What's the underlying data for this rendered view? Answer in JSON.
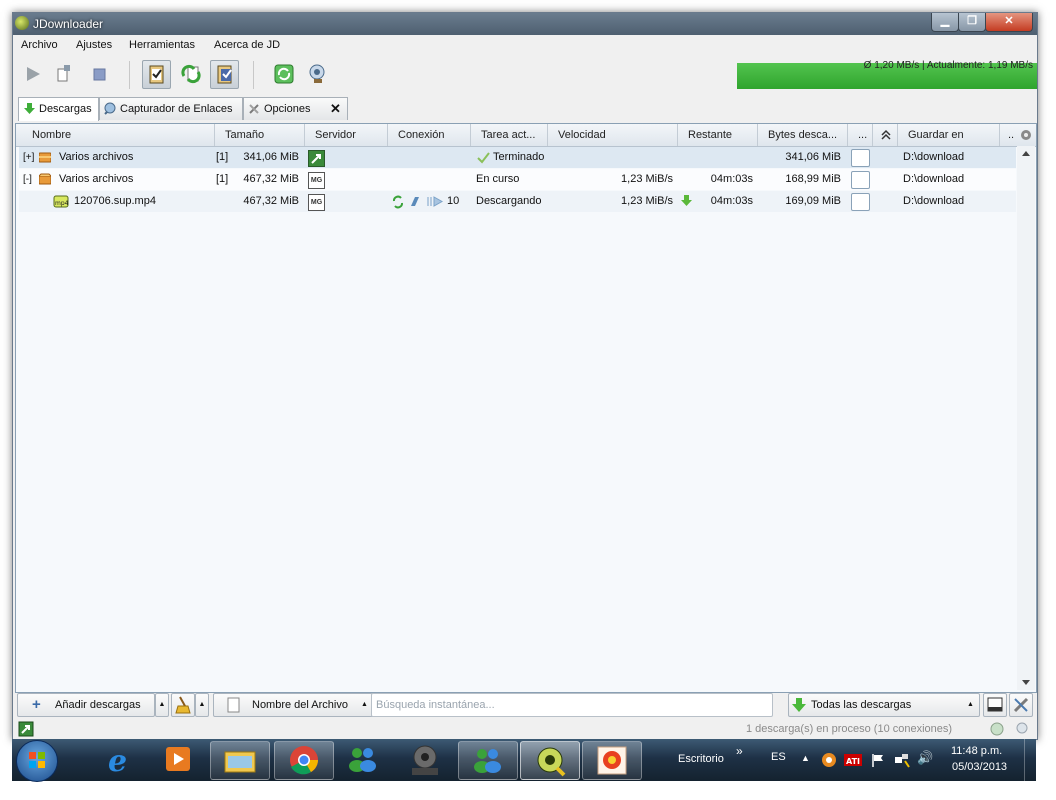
{
  "window": {
    "title": "JDownloader"
  },
  "menu": [
    "Archivo",
    "Ajustes",
    "Herramientas",
    "Acerca de JD"
  ],
  "toolbar": {
    "speed_text": "Ø 1,20 MB/s | Actualmente: 1,19 MB/s",
    "icons": [
      "play-icon",
      "stop-after-icon",
      "stop-icon",
      "clipboard-observe-icon",
      "reconnect-icon",
      "premium-icon",
      "update-icon",
      "plugin-icon"
    ]
  },
  "tabs": [
    {
      "label": "Descargas",
      "icon": "download-arrow-icon"
    },
    {
      "label": "Capturador de Enlaces",
      "icon": "linkgrabber-icon"
    },
    {
      "label": "Opciones",
      "icon": "tools-icon"
    }
  ],
  "table": {
    "columns": [
      "Nombre",
      "Tamaño",
      "Servidor",
      "Conexión",
      "Tarea act...",
      "Velocidad",
      "Restante",
      "Bytes desca...",
      "...",
      "",
      "Guardar en",
      ".."
    ],
    "rows": [
      {
        "expander": "[+]",
        "name": "Varios archivos",
        "count": "[1]",
        "size": "341,06 MiB",
        "host": "hoster-icon",
        "connection": "",
        "status": "Terminado",
        "speed": "",
        "remaining": "",
        "bytes": "341,06 MiB",
        "save": "D:\\download"
      },
      {
        "expander": "[-]",
        "name": "Varios archivos",
        "count": "[1]",
        "size": "467,32 MiB",
        "host": "MG",
        "connection": "",
        "status": "En curso",
        "speed": "1,23 MiB/s",
        "remaining": "04m:03s",
        "bytes": "168,99 MiB",
        "save": "D:\\download"
      },
      {
        "expander": "",
        "name": "120706.sup.mp4",
        "count": "",
        "size": "467,32 MiB",
        "host": "MG",
        "connection": "10",
        "status": "Descargando",
        "speed": "1,23 MiB/s",
        "remaining": "04m:03s",
        "bytes": "169,09 MiB",
        "save": "D:\\download"
      }
    ]
  },
  "bottom": {
    "add_label": "Añadir descargas",
    "filter_label": "Nombre del Archivo",
    "search_placeholder": "Búsqueda instantánea...",
    "all_label": "Todas las descargas"
  },
  "status": {
    "text": "1 descarga(s) en proceso (10 conexiones)"
  },
  "taskbar": {
    "desktop_label": "Escritorio",
    "lang": "ES",
    "time": "11:48 p.m.",
    "date": "05/03/2013",
    "apps": [
      "internet-explorer-icon",
      "media-player-icon",
      "file-explorer-icon",
      "chrome-icon",
      "messenger-icon",
      "movie-maker-icon",
      "messenger-icon",
      "jdownloader-icon",
      "irfanview-icon"
    ]
  }
}
